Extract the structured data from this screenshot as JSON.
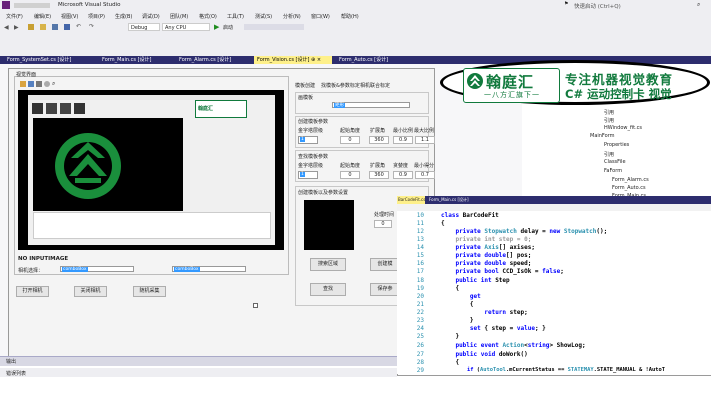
{
  "window": {
    "title": "Microsoft Visual Studio",
    "quick_launch": "快速启动 (Ctrl+Q)"
  },
  "menu": [
    "文件(F)",
    "编辑(E)",
    "视图(V)",
    "项目(P)",
    "生成(B)",
    "调试(D)",
    "团队(M)",
    "格式(O)",
    "工具(T)",
    "测试(S)",
    "分析(N)",
    "窗口(W)",
    "帮助(H)"
  ],
  "toolbar": {
    "config": "Debug",
    "platform": "Any CPU",
    "start": "启动"
  },
  "tabs": [
    "Form_SystemSet.cs [设计]",
    "Form_Main.cs [设计]",
    "Form_Alarm.cs [设计]",
    "Form_Vision.cs [设计]",
    "Form_Auto.cs [设计]"
  ],
  "form": {
    "preview_group": "视觉界面",
    "inner_app_logo": "翰庭汇",
    "status_label": "NO INPUTIMAGE",
    "camera_label": "相机选择：",
    "open_camera": "打开相机",
    "close_camera": "关闭相机",
    "collect_button": "随机采集",
    "right_tabs": [
      "模板创建",
      "找模板&参数标定",
      "相机联合标定"
    ],
    "template_group": "画模板",
    "create_params_group": "创建模板参数",
    "create_headers": [
      "金字塔层级",
      "起始角度",
      "扩展角",
      "最小比例",
      "最大比例"
    ],
    "create_values": [
      "0",
      "360",
      "0.9",
      "1.1"
    ],
    "find_params_group": "查找模板参数",
    "find_headers": [
      "金字塔层级",
      "起始角度",
      "扩展角",
      "贪婪度",
      "最小得分"
    ],
    "find_values": [
      "0",
      "360",
      "0.9",
      "0.7"
    ],
    "create_template_group": "创建模板以及参数设置",
    "search_region": "搜索区域",
    "create_label": "创建模",
    "process_time": "处理时间",
    "find_button": "查找",
    "save_button": "保存参"
  },
  "solution": {
    "items": [
      "引用",
      "引用",
      "HWindow_fit.cs",
      "MainForm",
      "Properties",
      "引用",
      "ClassFile",
      "FaForm",
      "Form_Alarm.cs",
      "Form_Auto.cs",
      "Form_Main.cs"
    ]
  },
  "logo": {
    "brand": "翰庭汇",
    "tagline": "一八方汇旗下一",
    "line1": "专注机器视觉教育",
    "line2": "C#  运动控制卡 视觉"
  },
  "code": {
    "tabs": [
      "BarCodeFit.cs",
      "Form_Main.cs [设计]"
    ],
    "lines": [
      {
        "n": "10",
        "text": "class BarCodeFit"
      },
      {
        "n": "11",
        "text": "{"
      },
      {
        "n": "12",
        "text": "    private Stopwatch delay = new Stopwatch();"
      },
      {
        "n": "13",
        "text": "    private int step = 0;"
      },
      {
        "n": "14",
        "text": "    private Axis[] axises;"
      },
      {
        "n": "15",
        "text": "    private double[] pos;"
      },
      {
        "n": "16",
        "text": "    private double speed;"
      },
      {
        "n": "17",
        "text": "    private bool CCD_IsOk = false;"
      },
      {
        "n": "18",
        "text": "    public int Step"
      },
      {
        "n": "19",
        "text": "    {"
      },
      {
        "n": "20",
        "text": "        get"
      },
      {
        "n": "21",
        "text": "        {"
      },
      {
        "n": "22",
        "text": "            return step;"
      },
      {
        "n": "23",
        "text": "        }"
      },
      {
        "n": "24",
        "text": "        set { step = value; }"
      },
      {
        "n": "25",
        "text": "    }"
      },
      {
        "n": "26",
        "text": "    public event Action<string> ShowLog;"
      },
      {
        "n": "27",
        "text": "    public void doWork()"
      },
      {
        "n": "28",
        "text": "    {"
      },
      {
        "n": "29",
        "text": "        if (AutoTool.mCurrentStatus == STATEMAY.STATE_MANUAL & !AutoT"
      }
    ]
  },
  "output": {
    "title": "输出",
    "errors": "错误列表"
  },
  "colors": {
    "vs_chrome": "#eeeef2",
    "tab_bg": "#2d2d6e",
    "active_tab": "#fef08a",
    "brand_green": "#117a3d"
  }
}
